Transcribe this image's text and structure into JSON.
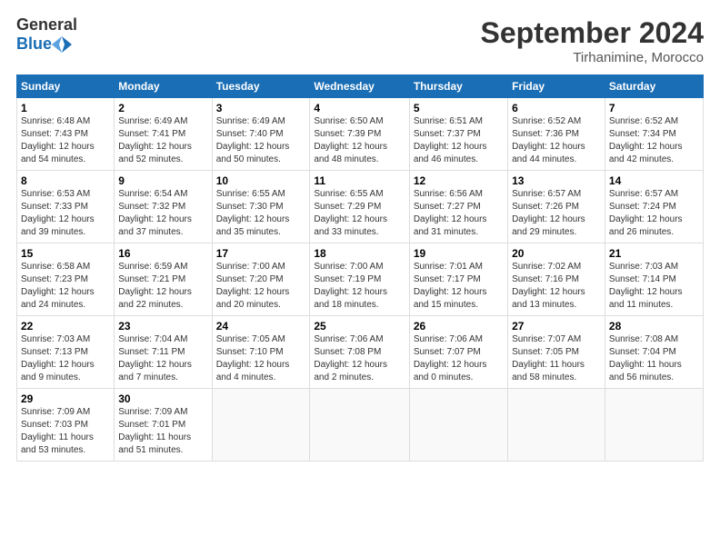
{
  "header": {
    "logo_general": "General",
    "logo_blue": "Blue",
    "month_title": "September 2024",
    "subtitle": "Tirhanimine, Morocco"
  },
  "days_of_week": [
    "Sunday",
    "Monday",
    "Tuesday",
    "Wednesday",
    "Thursday",
    "Friday",
    "Saturday"
  ],
  "weeks": [
    [
      {
        "day": "1",
        "sunrise": "6:48 AM",
        "sunset": "7:43 PM",
        "daylight": "12 hours",
        "minutes": "54"
      },
      {
        "day": "2",
        "sunrise": "6:49 AM",
        "sunset": "7:41 PM",
        "daylight": "12 hours",
        "minutes": "52"
      },
      {
        "day": "3",
        "sunrise": "6:49 AM",
        "sunset": "7:40 PM",
        "daylight": "12 hours",
        "minutes": "50"
      },
      {
        "day": "4",
        "sunrise": "6:50 AM",
        "sunset": "7:39 PM",
        "daylight": "12 hours",
        "minutes": "48"
      },
      {
        "day": "5",
        "sunrise": "6:51 AM",
        "sunset": "7:37 PM",
        "daylight": "12 hours",
        "minutes": "46"
      },
      {
        "day": "6",
        "sunrise": "6:52 AM",
        "sunset": "7:36 PM",
        "daylight": "12 hours",
        "minutes": "44"
      },
      {
        "day": "7",
        "sunrise": "6:52 AM",
        "sunset": "7:34 PM",
        "daylight": "12 hours",
        "minutes": "42"
      }
    ],
    [
      {
        "day": "8",
        "sunrise": "6:53 AM",
        "sunset": "7:33 PM",
        "daylight": "12 hours",
        "minutes": "39"
      },
      {
        "day": "9",
        "sunrise": "6:54 AM",
        "sunset": "7:32 PM",
        "daylight": "12 hours",
        "minutes": "37"
      },
      {
        "day": "10",
        "sunrise": "6:55 AM",
        "sunset": "7:30 PM",
        "daylight": "12 hours",
        "minutes": "35"
      },
      {
        "day": "11",
        "sunrise": "6:55 AM",
        "sunset": "7:29 PM",
        "daylight": "12 hours",
        "minutes": "33"
      },
      {
        "day": "12",
        "sunrise": "6:56 AM",
        "sunset": "7:27 PM",
        "daylight": "12 hours",
        "minutes": "31"
      },
      {
        "day": "13",
        "sunrise": "6:57 AM",
        "sunset": "7:26 PM",
        "daylight": "12 hours",
        "minutes": "29"
      },
      {
        "day": "14",
        "sunrise": "6:57 AM",
        "sunset": "7:24 PM",
        "daylight": "12 hours",
        "minutes": "26"
      }
    ],
    [
      {
        "day": "15",
        "sunrise": "6:58 AM",
        "sunset": "7:23 PM",
        "daylight": "12 hours",
        "minutes": "24"
      },
      {
        "day": "16",
        "sunrise": "6:59 AM",
        "sunset": "7:21 PM",
        "daylight": "12 hours",
        "minutes": "22"
      },
      {
        "day": "17",
        "sunrise": "7:00 AM",
        "sunset": "7:20 PM",
        "daylight": "12 hours",
        "minutes": "20"
      },
      {
        "day": "18",
        "sunrise": "7:00 AM",
        "sunset": "7:19 PM",
        "daylight": "12 hours",
        "minutes": "18"
      },
      {
        "day": "19",
        "sunrise": "7:01 AM",
        "sunset": "7:17 PM",
        "daylight": "12 hours",
        "minutes": "15"
      },
      {
        "day": "20",
        "sunrise": "7:02 AM",
        "sunset": "7:16 PM",
        "daylight": "12 hours",
        "minutes": "13"
      },
      {
        "day": "21",
        "sunrise": "7:03 AM",
        "sunset": "7:14 PM",
        "daylight": "12 hours",
        "minutes": "11"
      }
    ],
    [
      {
        "day": "22",
        "sunrise": "7:03 AM",
        "sunset": "7:13 PM",
        "daylight": "12 hours",
        "minutes": "9"
      },
      {
        "day": "23",
        "sunrise": "7:04 AM",
        "sunset": "7:11 PM",
        "daylight": "12 hours",
        "minutes": "7"
      },
      {
        "day": "24",
        "sunrise": "7:05 AM",
        "sunset": "7:10 PM",
        "daylight": "12 hours",
        "minutes": "4"
      },
      {
        "day": "25",
        "sunrise": "7:06 AM",
        "sunset": "7:08 PM",
        "daylight": "12 hours",
        "minutes": "2"
      },
      {
        "day": "26",
        "sunrise": "7:06 AM",
        "sunset": "7:07 PM",
        "daylight": "12 hours",
        "minutes": "0"
      },
      {
        "day": "27",
        "sunrise": "7:07 AM",
        "sunset": "7:05 PM",
        "daylight": "11 hours",
        "minutes": "58"
      },
      {
        "day": "28",
        "sunrise": "7:08 AM",
        "sunset": "7:04 PM",
        "daylight": "11 hours",
        "minutes": "56"
      }
    ],
    [
      {
        "day": "29",
        "sunrise": "7:09 AM",
        "sunset": "7:03 PM",
        "daylight": "11 hours",
        "minutes": "53"
      },
      {
        "day": "30",
        "sunrise": "7:09 AM",
        "sunset": "7:01 PM",
        "daylight": "11 hours",
        "minutes": "51"
      },
      null,
      null,
      null,
      null,
      null
    ]
  ]
}
